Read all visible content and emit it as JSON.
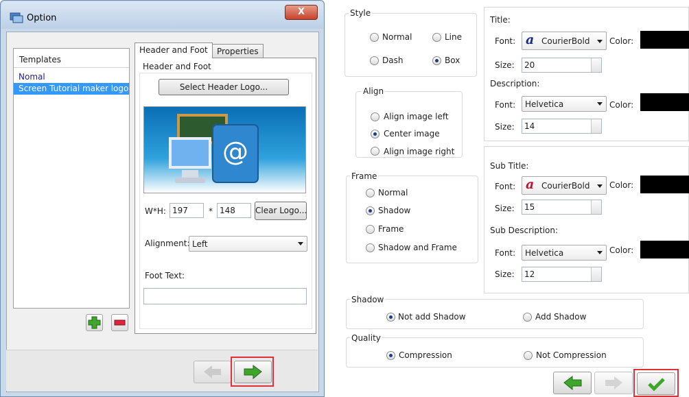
{
  "window": {
    "title": "Option",
    "close": "X"
  },
  "templates": {
    "header": "Templates",
    "items": [
      "Nomal",
      "Screen Tutorial maker logo"
    ]
  },
  "tabs": {
    "header_foot": "Header and Foot",
    "properties": "Properties"
  },
  "header_foot": {
    "group_label": "Header and Foot",
    "select_logo": "Select Header Logo...",
    "wh_label": "W*H:",
    "width": "197",
    "times": "*",
    "height": "148",
    "clear_logo": "Clear Logo...",
    "alignment_label": "Alignment:",
    "alignment_value": "Left",
    "foot_text_label": "Foot Text:",
    "foot_text_value": ""
  },
  "style": {
    "label": "Style",
    "normal": "Normal",
    "line": "Line",
    "dash": "Dash",
    "box": "Box",
    "selected": "Box"
  },
  "align": {
    "label": "Align",
    "left": "Align image left",
    "center": "Center image",
    "right": "Align image right",
    "selected": "Center image"
  },
  "frame": {
    "label": "Frame",
    "normal": "Normal",
    "shadow": "Shadow",
    "frame": "Frame",
    "shadow_frame": "Shadow and Frame",
    "selected": "Shadow"
  },
  "title_cfg": {
    "label": "Title:",
    "font_label": "Font:",
    "font": "CourierBold",
    "color_label": "Color:",
    "size_label": "Size:",
    "size": "20"
  },
  "desc_cfg": {
    "label": "Description:",
    "font_label": "Font:",
    "font": "Helvetica",
    "color_label": "Color:",
    "size_label": "Size:",
    "size": "14"
  },
  "subtitle_cfg": {
    "label": "Sub Title:",
    "font_label": "Font:",
    "font": "CourierBold",
    "color_label": "Color:",
    "size_label": "Size:",
    "size": "15"
  },
  "subdesc_cfg": {
    "label": "Sub Description:",
    "font_label": "Font:",
    "font": "Helvetica",
    "color_label": "Color:",
    "size_label": "Size:",
    "size": "12"
  },
  "shadow": {
    "label": "Shadow",
    "not_add": "Not add Shadow",
    "add": "Add Shadow",
    "selected": "Not add Shadow"
  },
  "quality": {
    "label": "Quality",
    "compression": "Compression",
    "no_compression": "Not Compression",
    "selected": "Compression"
  },
  "colors": {
    "accent_highlight": "#e0303a",
    "selection": "#3399ff",
    "arrow_green": "#3fa62b",
    "color_swatch": "#000000"
  }
}
